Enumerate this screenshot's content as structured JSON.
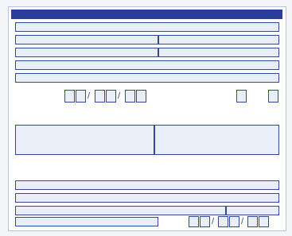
{
  "banner": "",
  "section_title": "",
  "field_labels": {
    "r1": "",
    "r2a": "",
    "r2b": "",
    "r3a": "",
    "r3b": "",
    "r4": "",
    "date_label": "",
    "side_a": "",
    "side_b": "",
    "note_1": "",
    "note_2": "",
    "left_panel": "",
    "right_panel": "",
    "right_panel_2": "",
    "sec2_r1": "",
    "sec2_r3a": "",
    "sec2_r3b": "",
    "sec2_r4a": "",
    "sec2_r4b": ""
  },
  "colors": {
    "border": "#2f4a9d",
    "fill": "#e9eef9",
    "banner": "#2b3f9a"
  }
}
